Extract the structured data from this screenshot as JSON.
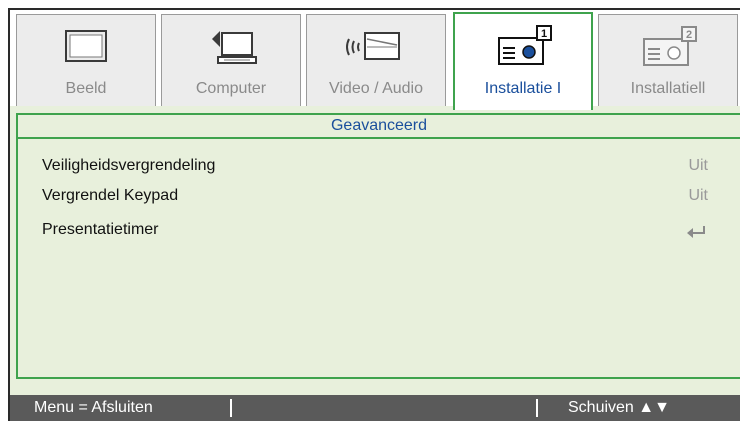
{
  "tabs": [
    {
      "label": "Beeld",
      "icon": "monitor-icon",
      "active": false
    },
    {
      "label": "Computer",
      "icon": "computer-icon",
      "active": false
    },
    {
      "label": "Video / Audio",
      "icon": "video-audio-icon",
      "active": false
    },
    {
      "label": "Installatie I",
      "icon": "projector-1-icon",
      "active": true
    },
    {
      "label": "Installatiell",
      "icon": "projector-2-icon",
      "active": false
    }
  ],
  "section_title": "Geavanceerd",
  "items": [
    {
      "label": "Veiligheidsvergrendeling",
      "value": "Uit"
    },
    {
      "label": "Vergrendel Keypad",
      "value": "Uit"
    },
    {
      "label": "Presentatietimer",
      "value": "",
      "icon": "enter-arrow-icon"
    }
  ],
  "status": {
    "left": "Menu = Afsluiten",
    "right": "Schuiven ▲▼"
  },
  "colors": {
    "panel_bg": "#e8f0dc",
    "active_border": "#3fa34d",
    "active_text": "#1a4f9c",
    "status_bg": "#5a5a5a"
  }
}
